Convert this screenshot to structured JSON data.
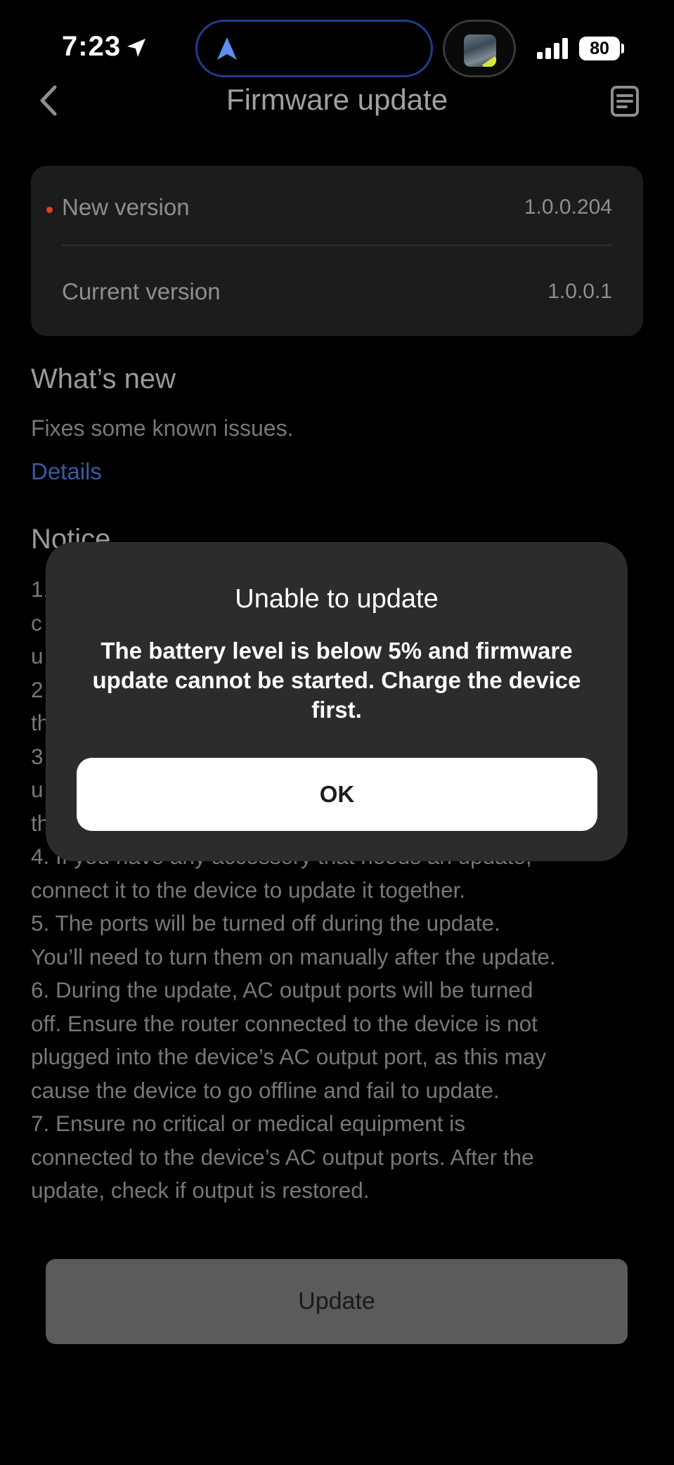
{
  "status_bar": {
    "time": "7:23",
    "battery": "80"
  },
  "header": {
    "title": "Firmware update"
  },
  "versions": {
    "new_label": "New version",
    "new_value": "1.0.0.204",
    "current_label": "Current version",
    "current_value": "1.0.0.1"
  },
  "whats_new": {
    "title": "What’s new",
    "body": "Fixes some known issues.",
    "details_link": "Details"
  },
  "notice": {
    "title": "Notice",
    "lines": [
      "1.",
      "c",
      "u",
      "2",
      "th",
      "3",
      "u",
      "th",
      "4. If you have any accessory that needs an update,",
      "connect it to the device to update it together.",
      "5. The ports will be turned off during the update.",
      "You’ll need to turn them on manually after the update.",
      "6. During the update, AC output ports will be turned",
      "off. Ensure the router connected to the device is not",
      "plugged into the device’s AC output port, as this may",
      "cause the device to go offline and fail to update.",
      "7. Ensure no critical or medical equipment is",
      "connected to the device’s AC output ports. After the",
      "update, check if output is restored."
    ]
  },
  "update_button": {
    "label": "Update"
  },
  "dialog": {
    "title": "Unable to update",
    "message": "The battery level is below 5% and firmware update cannot be started. Charge the device first.",
    "ok_label": "OK"
  },
  "colors": {
    "background": "#000000",
    "card": "#1c1c1e",
    "dialog": "#2c2c2e",
    "accent_dot": "#e0441e",
    "link": "#3b5a9e",
    "island_border": "#1e3e8c"
  },
  "icons": [
    "location-arrow-icon",
    "navigation-icon",
    "signal-icon",
    "battery-icon",
    "chevron-left-icon",
    "document-icon"
  ]
}
